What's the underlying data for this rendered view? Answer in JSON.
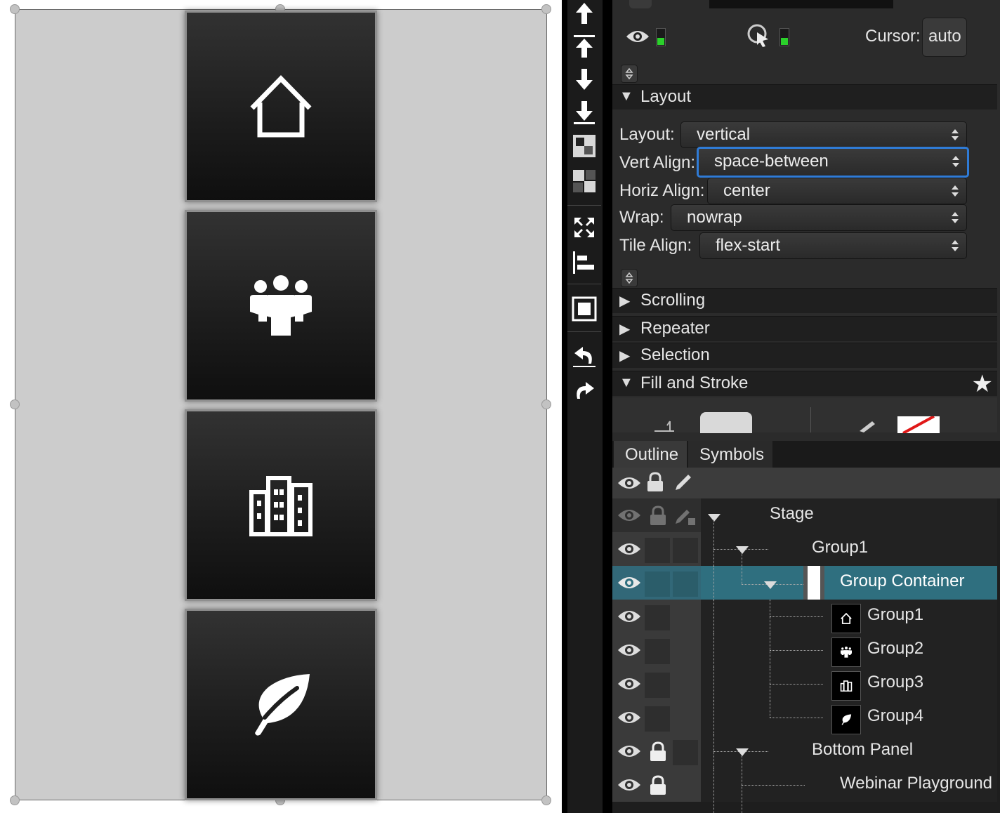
{
  "canvas": {
    "tiles": [
      {
        "icon": "home-icon"
      },
      {
        "icon": "people-group-icon"
      },
      {
        "icon": "buildings-icon"
      },
      {
        "icon": "leaf-icon"
      }
    ]
  },
  "toolbar": {
    "buttons": [
      "bring-to-front-icon",
      "bring-forward-icon",
      "send-backward-icon",
      "send-to-back-icon",
      "group-icon",
      "ungroup-icon",
      "fit-icon",
      "align-left-icon",
      "padding-icon",
      "undo-icon",
      "redo-icon"
    ]
  },
  "properties": {
    "cursor_label": "Cursor:",
    "cursor_value": "auto",
    "layout_section": "Layout",
    "layout_label": "Layout:",
    "layout_value": "vertical",
    "vert_align_label": "Vert Align:",
    "vert_align_value": "space-between",
    "horiz_align_label": "Horiz Align:",
    "horiz_align_value": "center",
    "wrap_label": "Wrap:",
    "wrap_value": "nowrap",
    "tile_align_label": "Tile Align:",
    "tile_align_value": "flex-start",
    "sections": [
      "Scrolling",
      "Repeater",
      "Selection"
    ],
    "fill_stroke_section": "Fill and Stroke"
  },
  "outline": {
    "tabs": [
      "Outline",
      "Symbols"
    ],
    "rows": [
      {
        "label": "Stage"
      },
      {
        "label": "Group1"
      },
      {
        "label": "Group Container"
      },
      {
        "label": "Group1"
      },
      {
        "label": "Group2"
      },
      {
        "label": "Group3"
      },
      {
        "label": "Group4"
      },
      {
        "label": "Bottom Panel"
      },
      {
        "label": "Webinar Playground"
      }
    ]
  },
  "colors": {
    "selection_row": "#2f6f7f",
    "focus_ring": "#2f7bd6",
    "canvas_bg": "#cccccc"
  }
}
